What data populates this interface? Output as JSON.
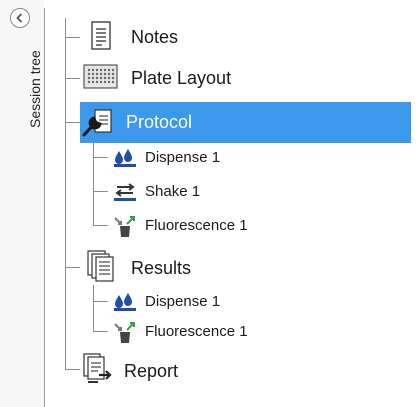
{
  "sidebar": {
    "title": "Session tree",
    "collapse_icon": "chevron-left-icon"
  },
  "tree": {
    "items": [
      {
        "label": "Notes",
        "icon": "notes-document-icon",
        "level": 0,
        "selected": false
      },
      {
        "label": "Plate Layout",
        "icon": "plate-grid-icon",
        "level": 0,
        "selected": false
      },
      {
        "label": "Protocol",
        "icon": "wrench-protocol-icon",
        "level": 0,
        "selected": true
      },
      {
        "label": "Dispense 1",
        "icon": "dispense-drops-icon",
        "level": 1,
        "selected": false
      },
      {
        "label": "Shake 1",
        "icon": "shake-arrows-icon",
        "level": 1,
        "selected": false
      },
      {
        "label": "Fluorescence 1",
        "icon": "fluorescence-icon",
        "level": 1,
        "selected": false
      },
      {
        "label": "Results",
        "icon": "results-pages-icon",
        "level": 0,
        "selected": false
      },
      {
        "label": "Dispense 1",
        "icon": "dispense-drops-icon",
        "level": 1,
        "selected": false
      },
      {
        "label": "Fluorescence 1",
        "icon": "fluorescence-icon",
        "level": 1,
        "selected": false
      },
      {
        "label": "Report",
        "icon": "report-export-icon",
        "level": 0,
        "selected": false
      }
    ]
  },
  "colors": {
    "selection": "#3c98ea",
    "tree_lines": "#8c8c8c",
    "dispense_blue": "#1e4fa8",
    "fluorescence_green": "#2ea043"
  }
}
